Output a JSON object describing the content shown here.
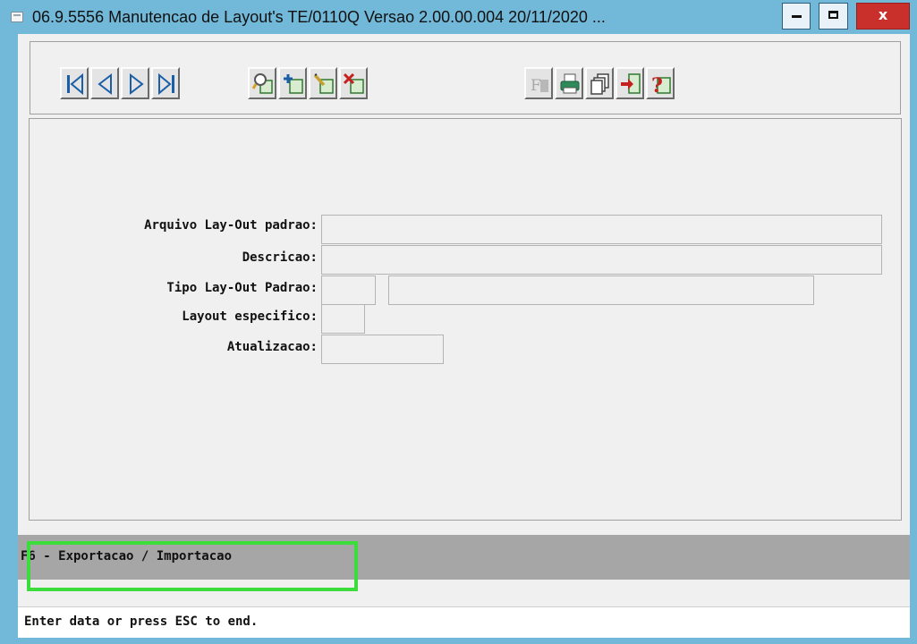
{
  "window": {
    "title": "06.9.5556 Manutencao  de Layout's TE/0110Q Versao 2.00.00.004 20/11/2020 ...",
    "close_glyph": "x"
  },
  "toolbar": {
    "buttons": [
      {
        "name": "first-record-icon"
      },
      {
        "name": "previous-record-icon"
      },
      {
        "name": "next-record-icon"
      },
      {
        "name": "last-record-icon"
      },
      {
        "name": "search-icon"
      },
      {
        "name": "add-record-icon"
      },
      {
        "name": "edit-record-icon"
      },
      {
        "name": "delete-record-icon"
      },
      {
        "name": "filter-icon"
      },
      {
        "name": "print-icon"
      },
      {
        "name": "copy-icon"
      },
      {
        "name": "exit-icon"
      },
      {
        "name": "help-icon"
      }
    ]
  },
  "form": {
    "arquivo_label": "Arquivo Lay-Out padrao:",
    "arquivo_value": "",
    "descricao_label": "Descricao:",
    "descricao_value": "",
    "tipo_label": "Tipo Lay-Out Padrao:",
    "tipo_code_value": "",
    "tipo_desc_value": "",
    "especifico_label": "Layout especifico:",
    "especifico_value": "",
    "atualizacao_label": "Atualizacao:",
    "atualizacao_value": ""
  },
  "fkeys": {
    "text": "F6 - Exportacao / Importacao"
  },
  "status": {
    "text": "Enter data or press ESC to end."
  },
  "colors": {
    "window_frame": "#72b8d9",
    "close_button": "#c9302c",
    "highlight": "#3cdc3c",
    "fkey_bar": "#a6a6a6"
  }
}
